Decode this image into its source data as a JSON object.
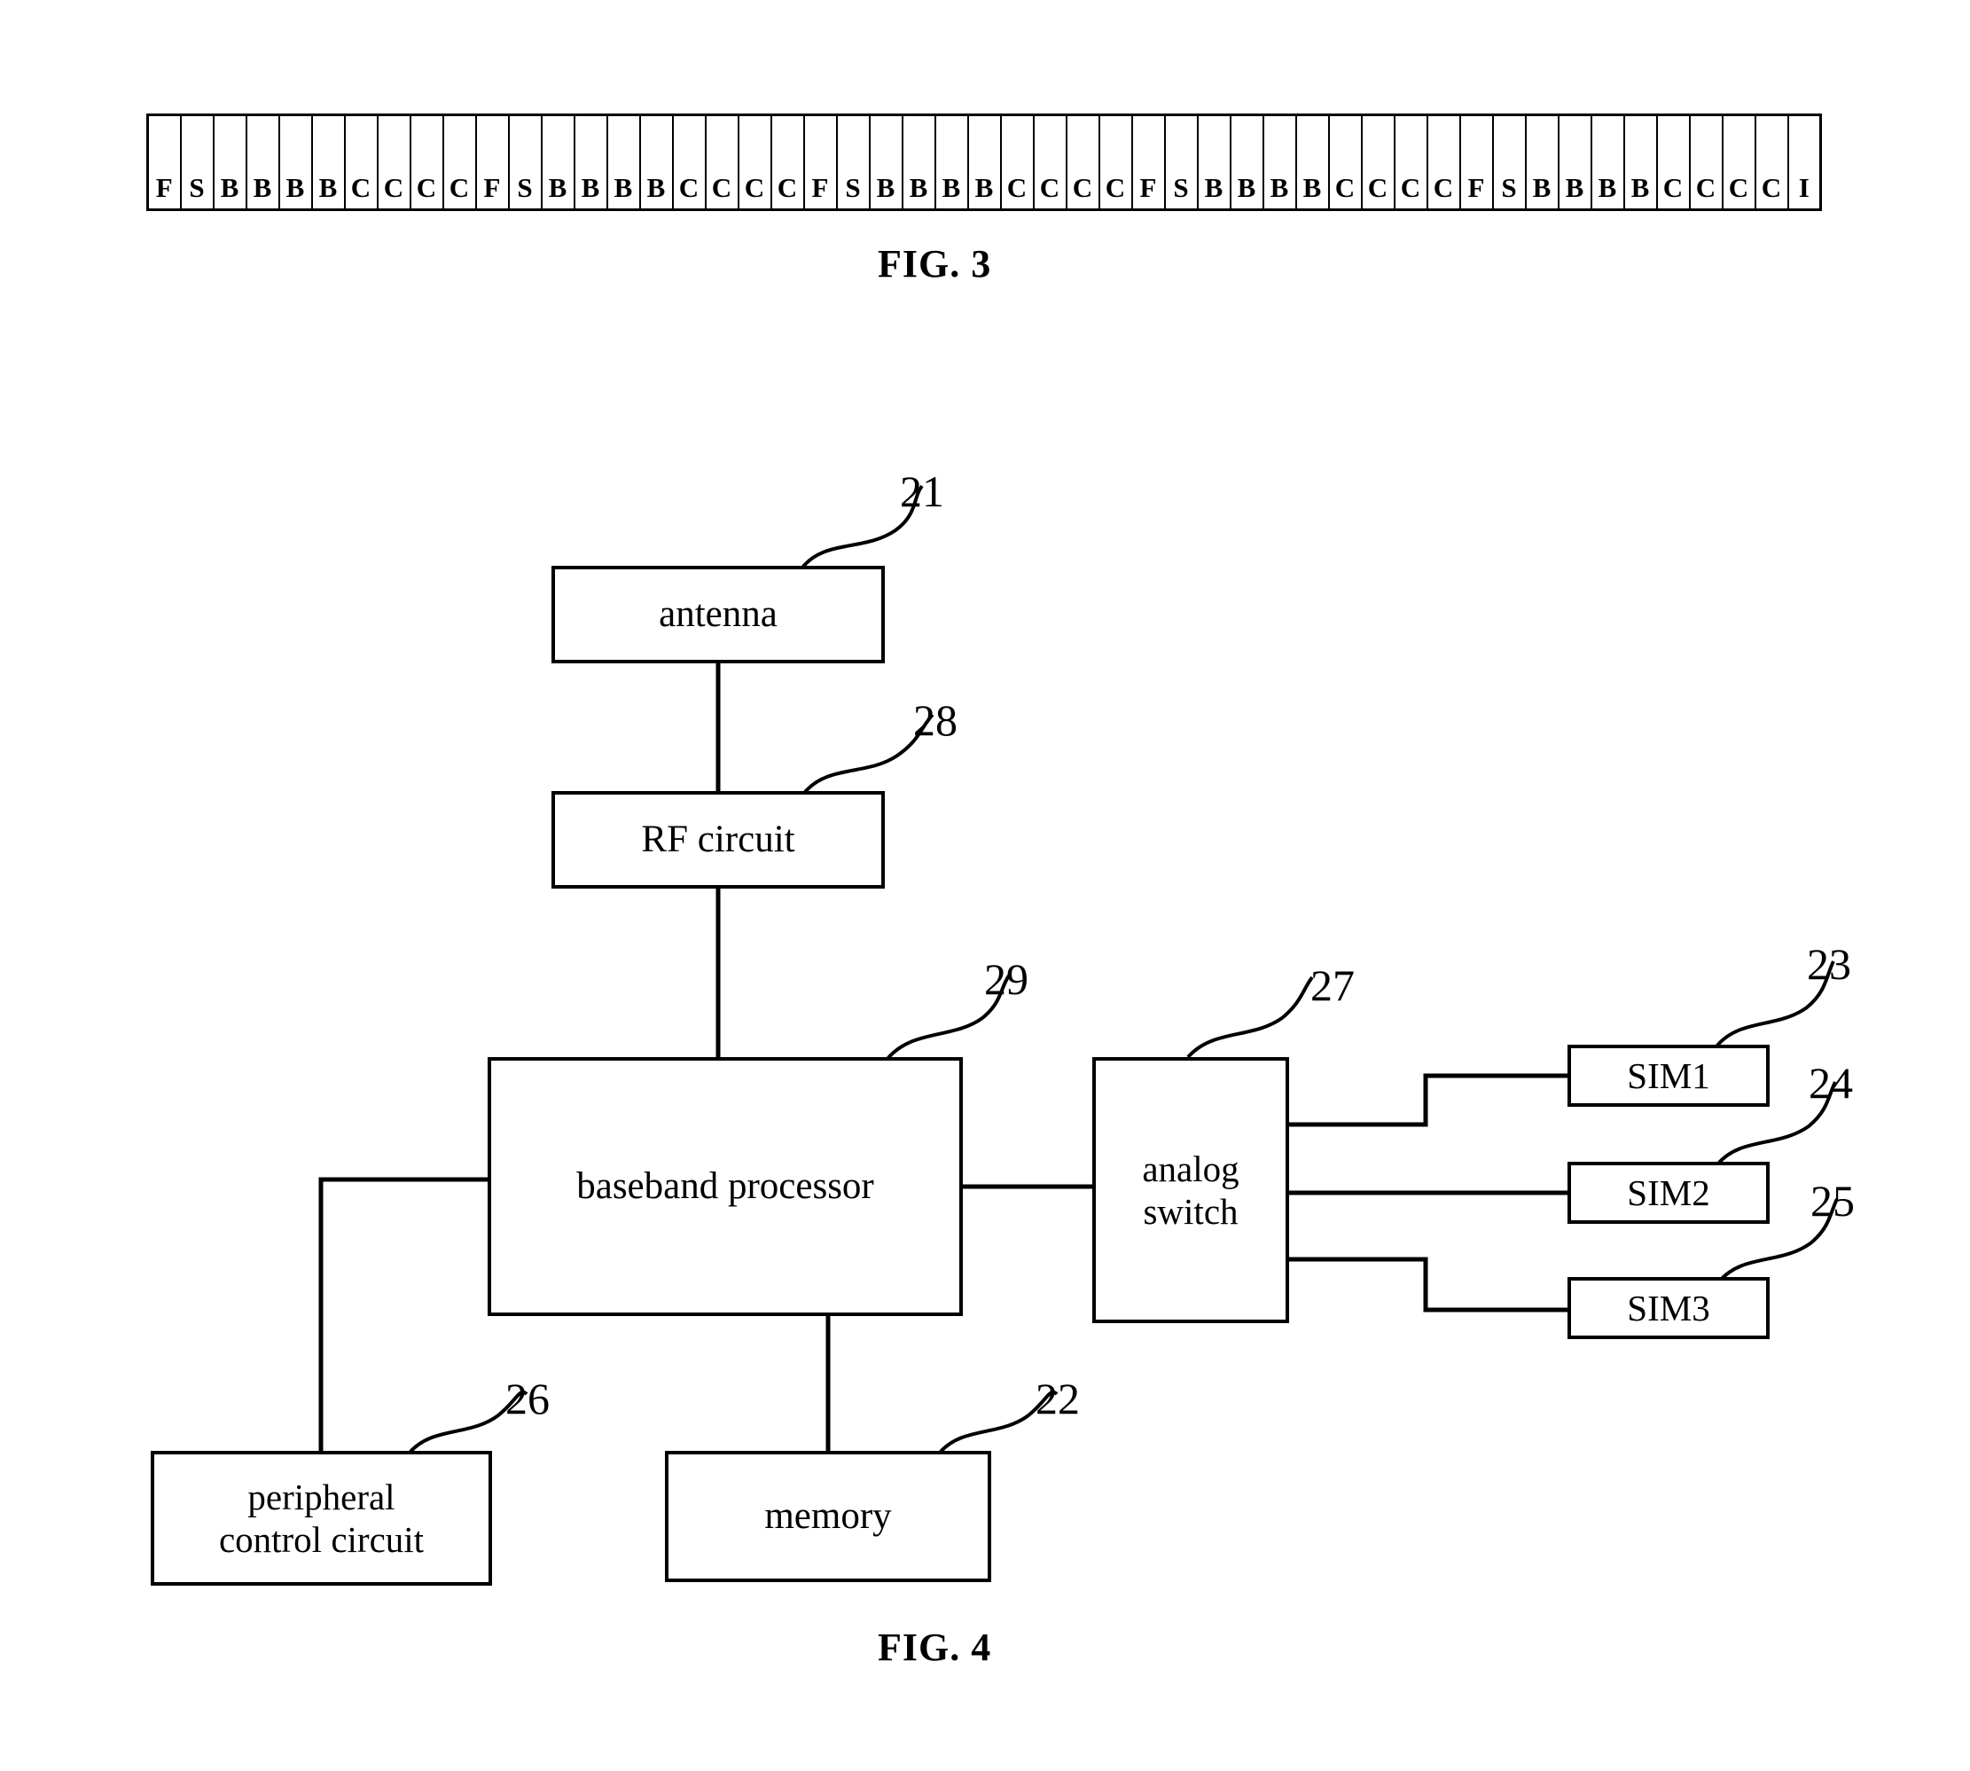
{
  "figures": [
    {
      "id": "fig3",
      "label": "FIG. 3",
      "type": "frame-slot-table",
      "cells": [
        "F",
        "S",
        "B",
        "B",
        "B",
        "B",
        "C",
        "C",
        "C",
        "C",
        "F",
        "S",
        "B",
        "B",
        "B",
        "B",
        "C",
        "C",
        "C",
        "C",
        "F",
        "S",
        "B",
        "B",
        "B",
        "B",
        "C",
        "C",
        "C",
        "C",
        "F",
        "S",
        "B",
        "B",
        "B",
        "B",
        "C",
        "C",
        "C",
        "C",
        "F",
        "S",
        "B",
        "B",
        "B",
        "B",
        "C",
        "C",
        "C",
        "C",
        "I"
      ]
    },
    {
      "id": "fig4",
      "label": "FIG. 4",
      "type": "block-diagram",
      "blocks": {
        "antenna": "antenna",
        "rf_circuit": "RF circuit",
        "baseband_processor": "baseband processor",
        "analog_switch_line1": "analog",
        "analog_switch_line2": "switch",
        "sim1": "SIM1",
        "sim2": "SIM2",
        "sim3": "SIM3",
        "peripheral_line1": "peripheral",
        "peripheral_line2": "control circuit",
        "memory": "memory"
      },
      "reference_numerals": {
        "antenna": "21",
        "memory": "22",
        "sim1": "23",
        "sim2": "24",
        "sim3": "25",
        "peripheral_control_circuit": "26",
        "analog_switch": "27",
        "rf_circuit": "28",
        "baseband_processor": "29"
      }
    }
  ],
  "colors": {
    "background": "#ffffff",
    "ink": "#000000"
  }
}
